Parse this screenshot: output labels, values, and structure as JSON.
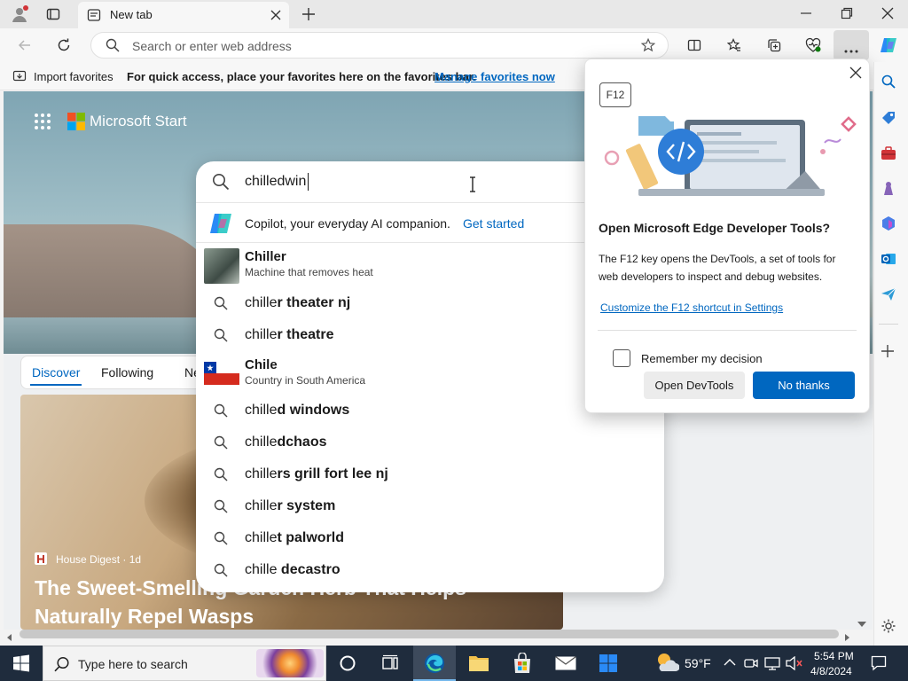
{
  "browser": {
    "tab_title": "New tab",
    "address_placeholder": "Search or enter web address"
  },
  "favorites_bar": {
    "import_label": "Import favorites",
    "hint": "For quick access, place your favorites here on the favorites bar.",
    "manage_link": "Manage favorites now"
  },
  "ms_start": {
    "brand": "Microsoft Start",
    "tabs": [
      "Discover",
      "Following",
      "Ne"
    ],
    "article_source": "House Digest · 1d",
    "article_title_1": "The Sweet-Smelling Garden Herb That Helps",
    "article_title_2": "Naturally Repel Wasps"
  },
  "search_dropdown": {
    "query": "chilledwin",
    "copilot_text": "Copilot, your everyday AI companion.",
    "copilot_link": "Get started",
    "entity_chiller": {
      "title": "Chiller",
      "subtitle": "Machine that removes heat"
    },
    "entity_chile": {
      "title": "Chile",
      "subtitle": "Country in South America"
    },
    "suggestions": [
      {
        "prefix": "chille",
        "bold": "r theater nj"
      },
      {
        "prefix": "chille",
        "bold": "r theatre"
      },
      {
        "prefix": "chille",
        "bold": "d windows"
      },
      {
        "prefix": "chille",
        "bold": "dchaos"
      },
      {
        "prefix": "chille",
        "bold": "rs grill fort lee nj"
      },
      {
        "prefix": "chille",
        "bold": "r system"
      },
      {
        "prefix": "chille",
        "bold": "t palworld"
      },
      {
        "prefix": "chille",
        "bold": " decastro"
      }
    ]
  },
  "devtools_popup": {
    "key_badge": "F12",
    "title": "Open Microsoft Edge Developer Tools?",
    "body": "The F12 key opens the DevTools, a set of tools for web developers to inspect and debug websites.",
    "settings_link": "Customize the F12 shortcut in Settings",
    "checkbox_label": "Remember my decision",
    "open_button": "Open DevTools",
    "no_button": "No thanks"
  },
  "taskbar": {
    "search_placeholder": "Type here to search",
    "weather": "59°F",
    "time": "5:54 PM",
    "date": "4/8/2024"
  },
  "colors": {
    "accent": "#0067c0",
    "taskbar": "#1f2c3d"
  }
}
